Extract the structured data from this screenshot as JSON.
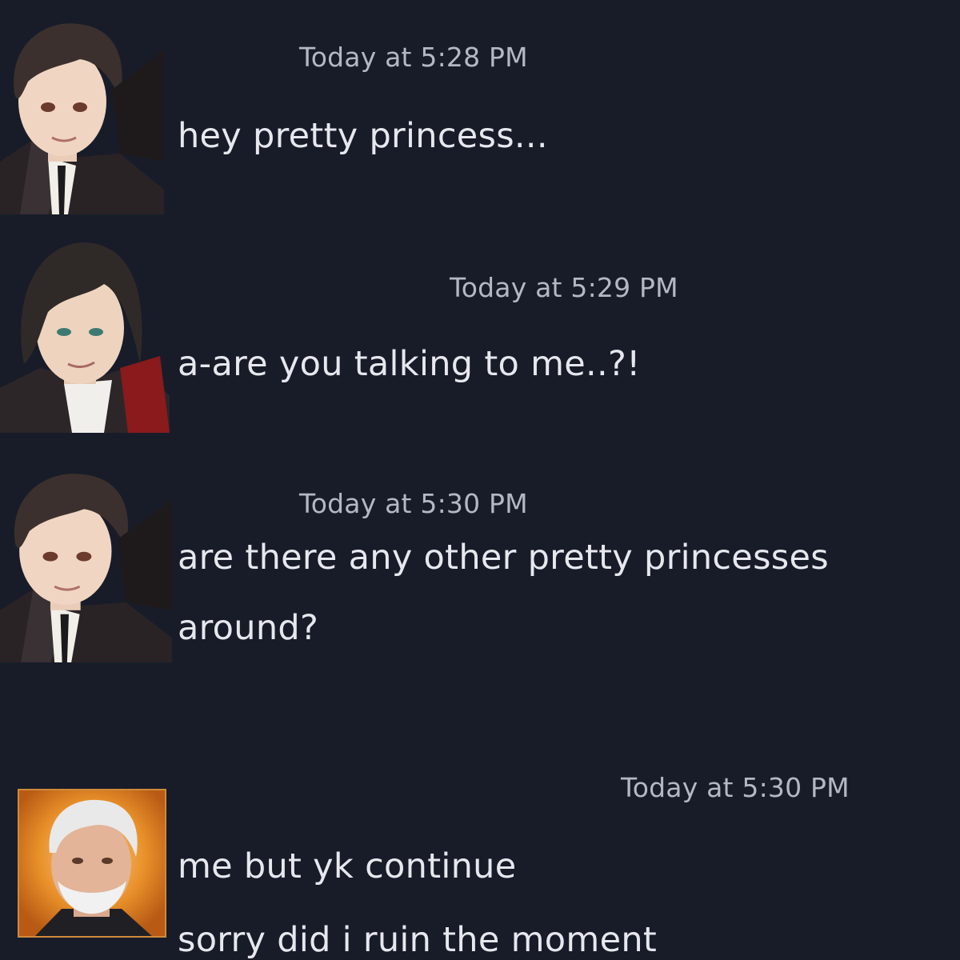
{
  "messages": [
    {
      "avatar_icon": "dark-haired-man-avatar-icon",
      "timestamp": "Today at 5:28 PM",
      "lines": [
        "hey pretty princess..."
      ]
    },
    {
      "avatar_icon": "long-haired-man-avatar-icon",
      "timestamp": "Today at 5:29 PM",
      "lines": [
        "a-are you talking to me..?!"
      ]
    },
    {
      "avatar_icon": "dark-haired-man-avatar-icon",
      "timestamp": "Today at 5:30 PM",
      "lines": [
        "are there any other pretty princesses",
        "around?"
      ]
    },
    {
      "avatar_icon": "white-bearded-man-avatar-icon",
      "timestamp": "Today at 5:30 PM",
      "lines": [
        "me but yk continue",
        "sorry did i ruin the moment"
      ]
    }
  ],
  "colors": {
    "background": "#181c29",
    "timestamp": "#b4b8c2",
    "message_text": "#e6e8ee",
    "avatar4_frame": "#e8902a"
  }
}
